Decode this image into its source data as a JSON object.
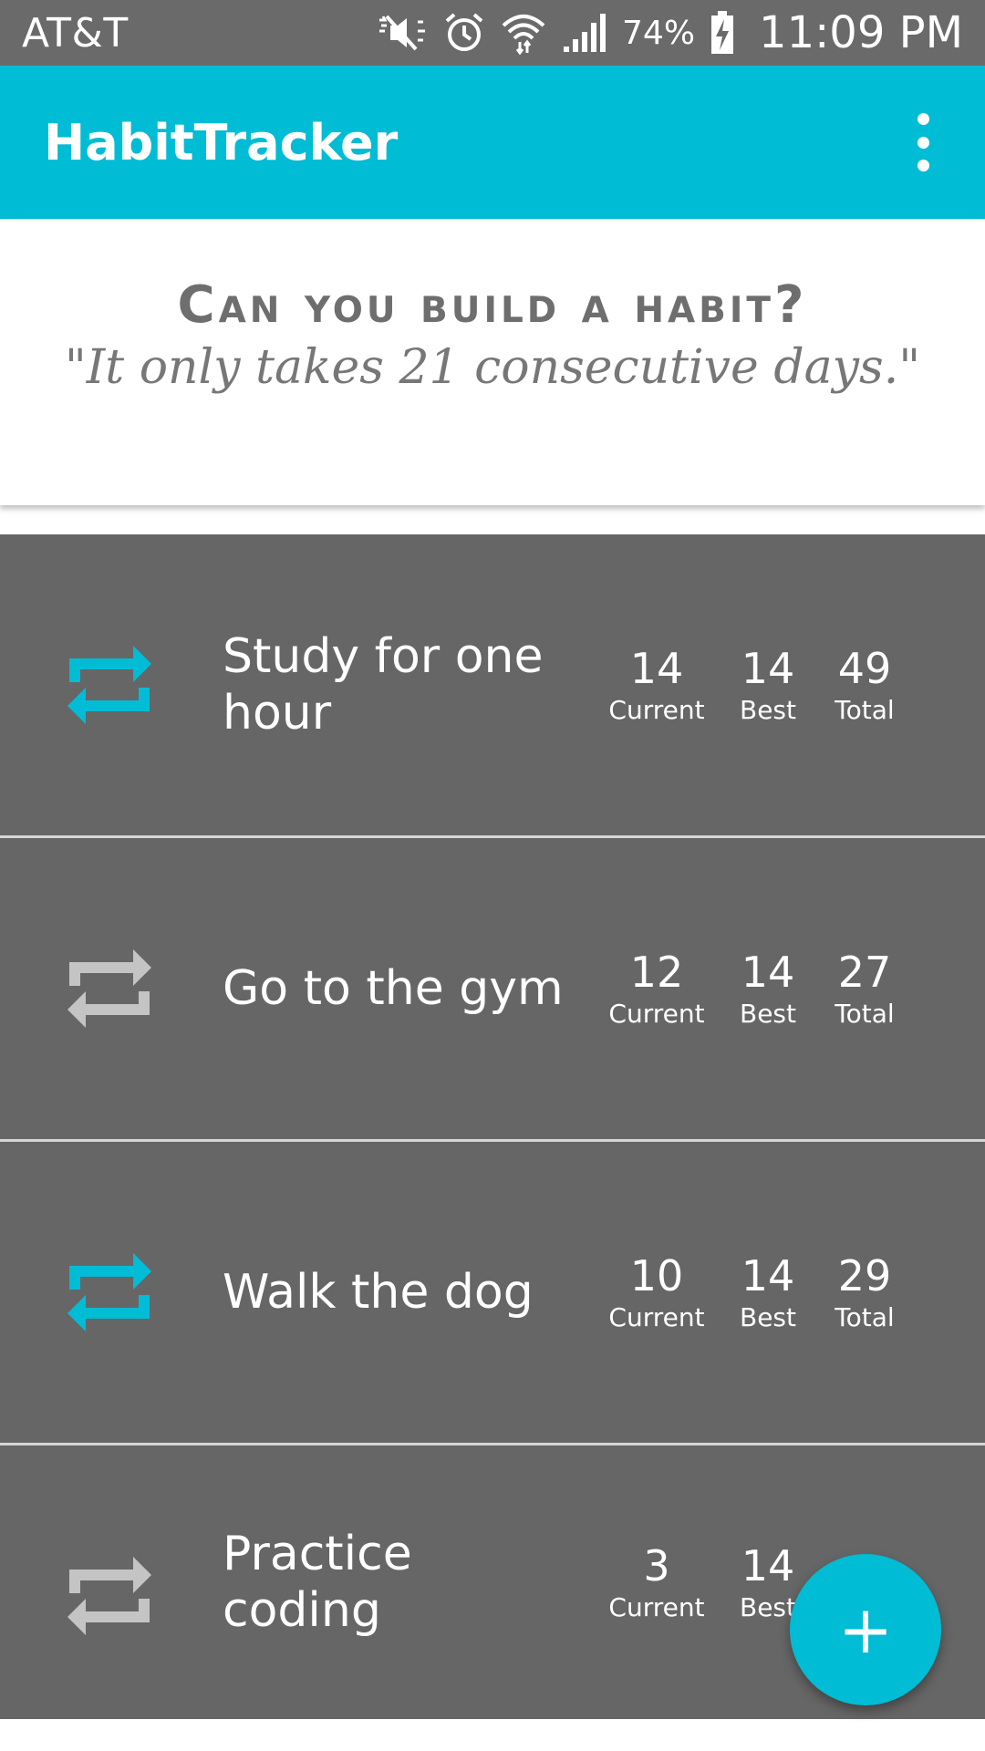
{
  "status_bar": {
    "carrier": "AT&T",
    "battery": "74%",
    "time": "11:09 PM",
    "icons": [
      "mute-icon",
      "alarm-icon",
      "wifi-icon",
      "signal-icon",
      "battery-charging-icon"
    ]
  },
  "app_bar": {
    "title": "HabitTracker",
    "menu_icon": "more-vert-icon"
  },
  "header": {
    "headline": "Can you build a habit?",
    "quote": "\"It only takes 21 consecutive days.\""
  },
  "labels": {
    "current": "Current",
    "best": "Best",
    "total": "Total"
  },
  "habits": [
    {
      "name": "Study for one hour",
      "current": "14",
      "best": "14",
      "total": "49",
      "checked": true
    },
    {
      "name": "Go to the gym",
      "current": "12",
      "best": "14",
      "total": "27",
      "checked": false
    },
    {
      "name": "Walk the dog",
      "current": "10",
      "best": "14",
      "total": "29",
      "checked": true
    },
    {
      "name": "Practice coding",
      "current": "3",
      "best": "14",
      "total": "",
      "checked": false
    }
  ],
  "fab": {
    "label": "+",
    "icon": "add-icon"
  },
  "colors": {
    "accent": "#00bcd4",
    "row_background": "#666666",
    "icon_inactive": "#c4c4c4",
    "status_bar": "#6a6a6a"
  }
}
